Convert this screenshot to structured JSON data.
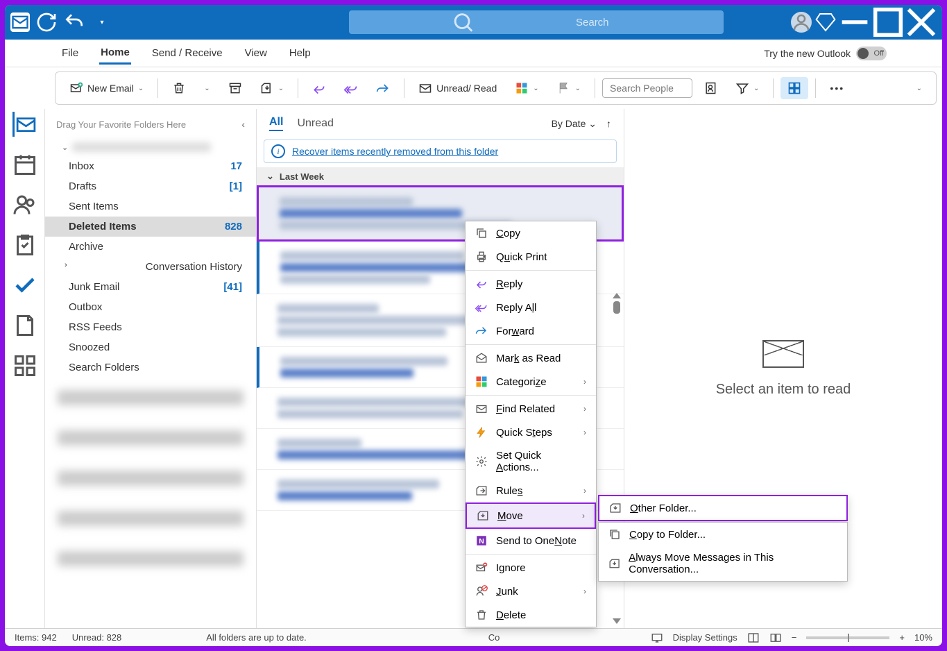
{
  "titlebar": {
    "search_placeholder": "Search"
  },
  "menu": {
    "file": "File",
    "home": "Home",
    "sendreceive": "Send / Receive",
    "view": "View",
    "help": "Help",
    "try_new": "Try the new Outlook",
    "toggle_off": "Off"
  },
  "toolbar": {
    "new_email": "New Email",
    "unread_read": "Unread/ Read",
    "search_people": "Search People"
  },
  "folders": {
    "drag_hint": "Drag Your Favorite Folders Here",
    "inbox": "Inbox",
    "inbox_cnt": "17",
    "drafts": "Drafts",
    "drafts_cnt": "[1]",
    "sent": "Sent Items",
    "deleted": "Deleted Items",
    "deleted_cnt": "828",
    "archive": "Archive",
    "conv_history": "Conversation History",
    "junk": "Junk Email",
    "junk_cnt": "[41]",
    "outbox": "Outbox",
    "rss": "RSS Feeds",
    "snoozed": "Snoozed",
    "search_folders": "Search Folders"
  },
  "msglist": {
    "all": "All",
    "unread": "Unread",
    "bydate": "By Date",
    "recover": "Recover items recently removed from this folder",
    "group": "Last Week"
  },
  "reading": {
    "select": "Select an item to read"
  },
  "ctx": {
    "copy": "Copy",
    "quick_print": "Quick Print",
    "reply": "Reply",
    "reply_all": "Reply All",
    "forward": "Forward",
    "mark_read": "Mark as Read",
    "categorize": "Categorize",
    "find_related": "Find Related",
    "quick_steps": "Quick Steps",
    "set_quick": "Set Quick Actions...",
    "rules": "Rules",
    "move": "Move",
    "onenote": "Send to OneNote",
    "ignore": "Ignore",
    "junk": "Junk",
    "delete": "Delete",
    "other_folder": "Other Folder...",
    "copy_folder": "Copy to Folder...",
    "always_move": "Always Move Messages in This Conversation..."
  },
  "status": {
    "items": "Items: 942",
    "unread": "Unread: 828",
    "folders_ok": "All folders are up to date.",
    "co": "Co",
    "display": "Display Settings",
    "zoom": "10%"
  }
}
